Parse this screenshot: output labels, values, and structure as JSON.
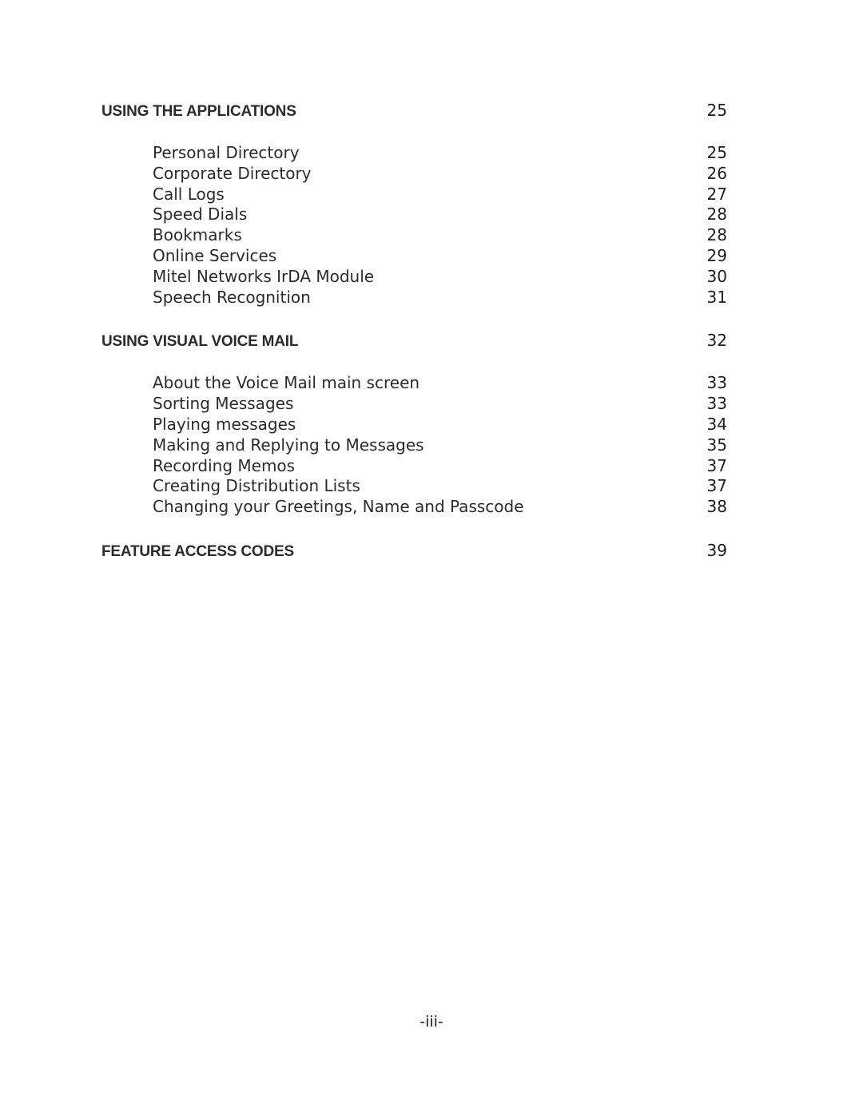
{
  "toc": {
    "sections": [
      {
        "title": "USING THE APPLICATIONS",
        "page": "25",
        "entries": [
          {
            "title": "Personal Directory",
            "page": "25"
          },
          {
            "title": "Corporate Directory",
            "page": "26"
          },
          {
            "title": "Call Logs",
            "page": "27"
          },
          {
            "title": "Speed Dials",
            "page": "28"
          },
          {
            "title": "Bookmarks",
            "page": "28"
          },
          {
            "title": "Online Services",
            "page": "29"
          },
          {
            "title": "Mitel Networks IrDA Module",
            "page": "30"
          },
          {
            "title": "Speech Recognition",
            "page": "31"
          }
        ]
      },
      {
        "title": "USING VISUAL VOICE MAIL",
        "page": "32",
        "entries": [
          {
            "title": "About the Voice Mail main screen",
            "page": "33"
          },
          {
            "title": "Sorting Messages",
            "page": "33"
          },
          {
            "title": "Playing messages",
            "page": "34"
          },
          {
            "title": "Making and Replying to Messages",
            "page": "35"
          },
          {
            "title": "Recording Memos",
            "page": "37"
          },
          {
            "title": "Creating Distribution Lists",
            "page": "37"
          },
          {
            "title": "Changing your Greetings, Name and Passcode",
            "page": "38"
          }
        ]
      },
      {
        "title": "FEATURE ACCESS CODES",
        "page": "39",
        "entries": []
      }
    ]
  },
  "footer": {
    "page_label": "-iii-"
  }
}
